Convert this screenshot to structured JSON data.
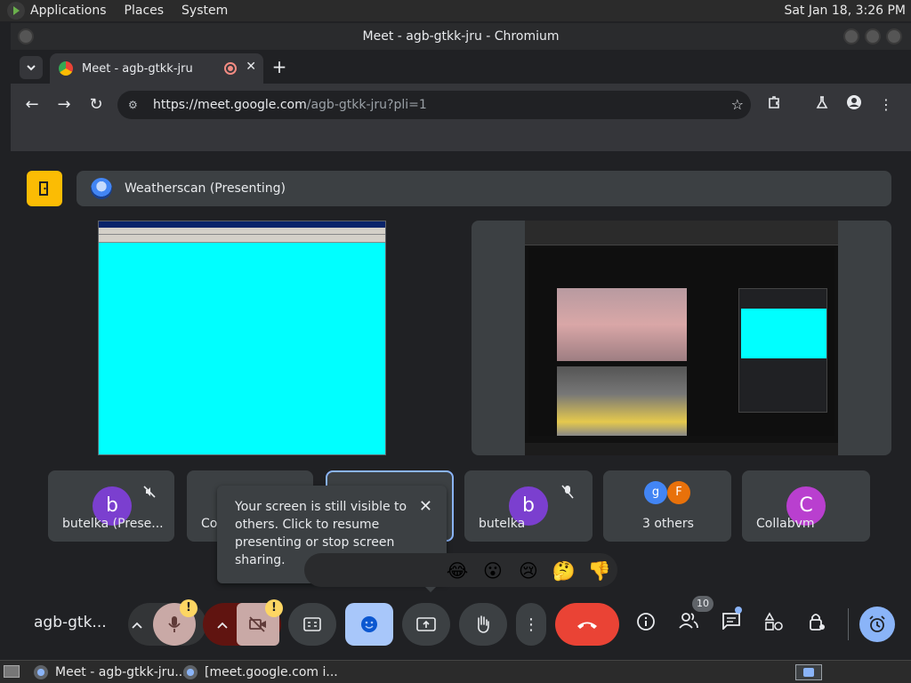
{
  "os": {
    "menus": [
      "Applications",
      "Places",
      "System"
    ],
    "clock": "Sat Jan 18,  3:26 PM"
  },
  "window": {
    "title": "Meet - agb-gtkk-jru - Chromium"
  },
  "browser": {
    "tab_title": "Meet - agb-gtkk-jru",
    "url_host": "https://meet.google.com",
    "url_path": "/agb-gtkk-jru?pli=1"
  },
  "meet": {
    "presenter_label": "Weatherscan (Presenting)",
    "tiles": [
      {
        "name": "butelka (Prese...",
        "avatar": "b",
        "avatar_color": "#7b3fcf"
      },
      {
        "name": "Co"
      },
      {
        "name": ""
      },
      {
        "name": "butelka",
        "avatar": "b",
        "avatar_color": "#7b3fcf"
      },
      {
        "name": "3 others",
        "avatars": [
          "g",
          "F"
        ]
      },
      {
        "name": "Collabvm",
        "avatar": "C",
        "avatar_color": "#b93fcf"
      }
    ],
    "tooltip_text": "Your screen is still visible to others. Click to resume presenting or stop screen sharing.",
    "reactions": [
      "😂",
      "😮",
      "😢",
      "🤔",
      "👎"
    ],
    "meeting_code": "agb-gtk...",
    "participant_count": "10",
    "warning_badge": "!"
  },
  "taskbar": {
    "items": [
      "Meet - agb-gtkk-jru...",
      "[meet.google.com i..."
    ]
  },
  "colors": {
    "accent": "#8ab4f8",
    "hangup": "#ea4335",
    "warn": "#fdd663",
    "exit": "#fbbc04",
    "cyan": "#00ffff"
  }
}
